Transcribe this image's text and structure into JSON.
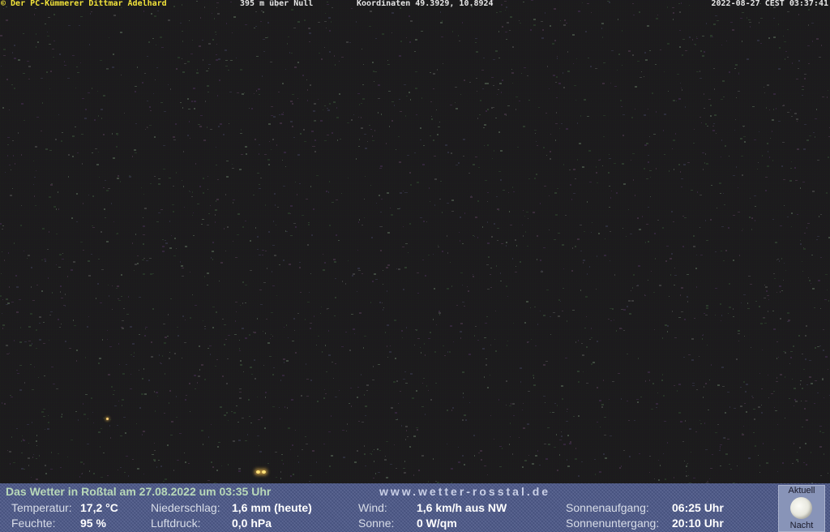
{
  "overlay": {
    "copyright": "© Der PC-Kümmerer Dittmar Adelhard",
    "altitude": "395 m über Null",
    "coordinates": "Koordinaten 49.3929, 10.8924",
    "timestamp": "2022-08-27 CEST 03:37:41"
  },
  "weather": {
    "title": "Das Wetter in Roßtal am 27.08.2022 um 03:35 Uhr",
    "site": "www.wetter-rosstal.de",
    "temperature_label": "Temperatur:",
    "temperature_value": "17,2 °C",
    "humidity_label": "Feuchte:",
    "humidity_value": "95 %",
    "precip_label": "Niederschlag:",
    "precip_value": "1,6 mm (heute)",
    "pressure_label": "Luftdruck:",
    "pressure_value": "0,0 hPa",
    "wind_label": "Wind:",
    "wind_value": "1,6 km/h aus NW",
    "sun_label": "Sonne:",
    "sun_value": "0 W/qm",
    "sunrise_label": "Sonnenaufgang:",
    "sunrise_value": "06:25 Uhr",
    "sunset_label": "Sonnenuntergang:",
    "sunset_value": "20:10 Uhr"
  },
  "moon": {
    "top_label": "Aktuell",
    "bottom_label": "Nacht"
  },
  "colors": {
    "overlay_copyright": "#f2e33a",
    "overlay_text": "#e6e6e6",
    "bar_bg": "#4a5687",
    "title_text": "#b8d8b8"
  }
}
